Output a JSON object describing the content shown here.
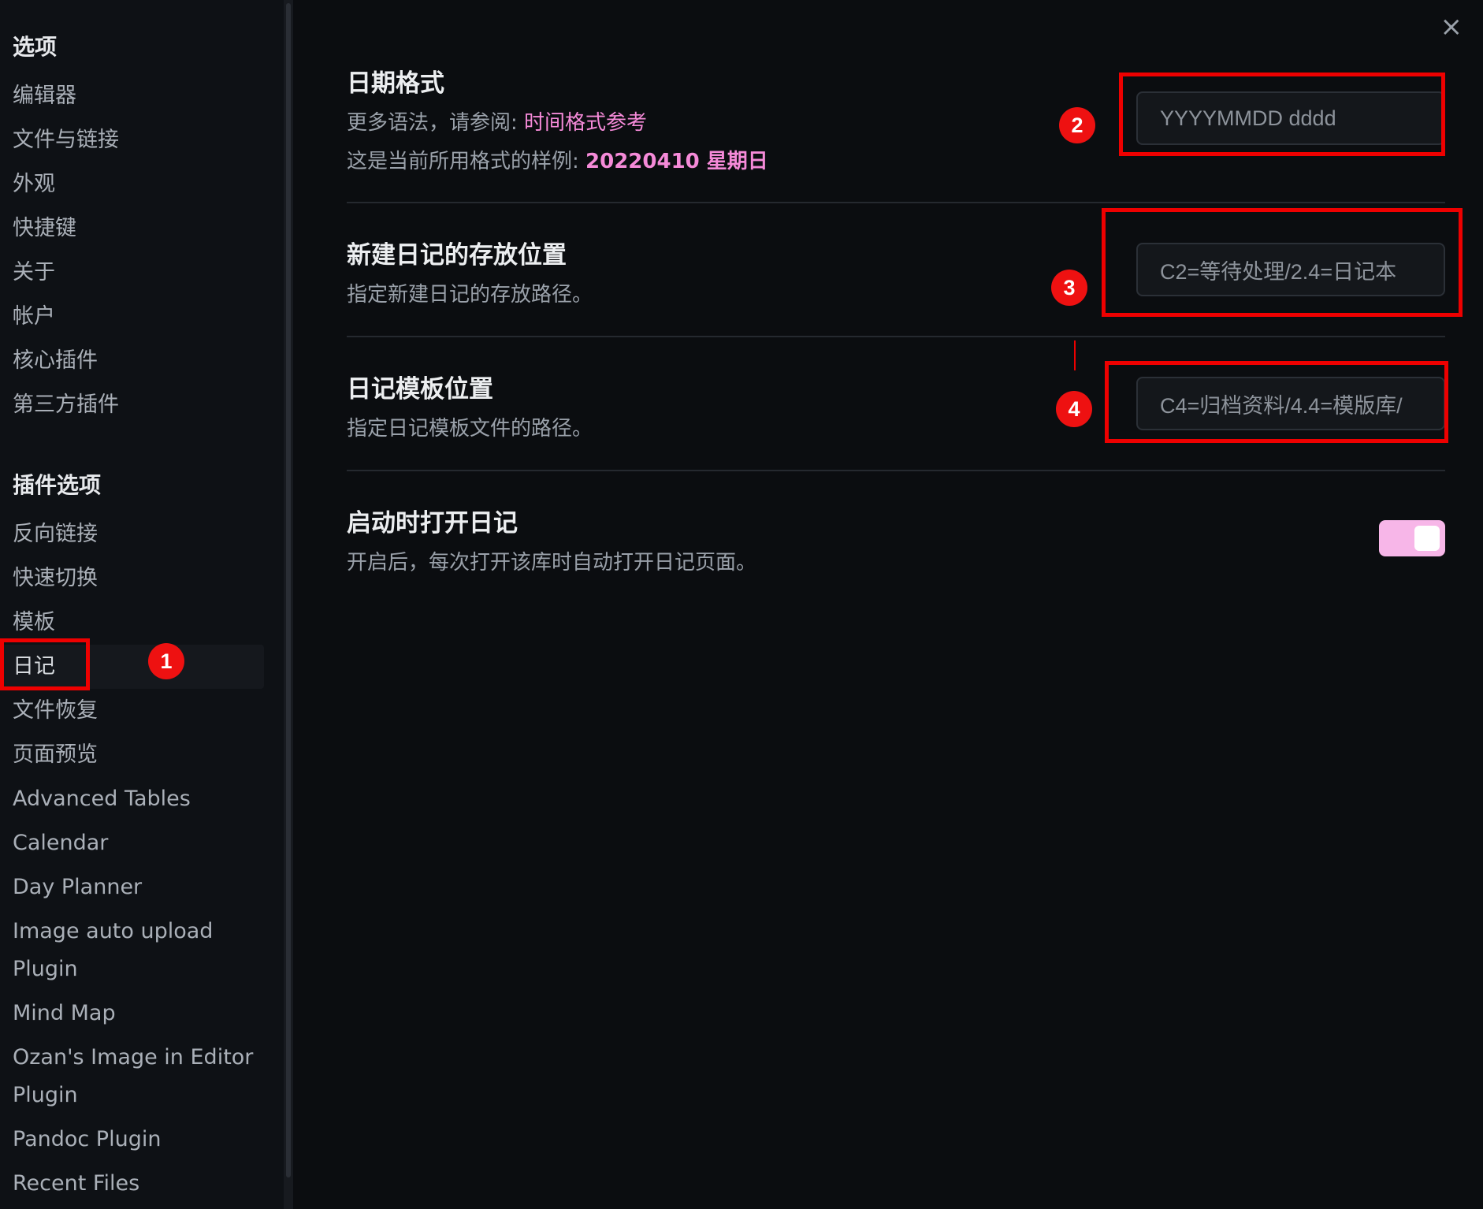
{
  "sidebar": {
    "options_heading": "选项",
    "options_items": [
      "编辑器",
      "文件与链接",
      "外观",
      "快捷键",
      "关于",
      "帐户",
      "核心插件",
      "第三方插件"
    ],
    "plugin_heading": "插件选项",
    "plugin_items": [
      "反向链接",
      "快速切换",
      "模板",
      "日记",
      "文件恢复",
      "页面预览",
      "Advanced Tables",
      "Calendar",
      "Day Planner",
      "Image auto upload Plugin",
      "Mind Map",
      "Ozan's Image in Editor Plugin",
      "Pandoc Plugin",
      "Recent Files"
    ],
    "active_item": "日记"
  },
  "badges": [
    "1",
    "2",
    "3",
    "4"
  ],
  "close_icon": "×",
  "settings": {
    "date_format": {
      "title": "日期格式",
      "desc_prefix": "更多语法，请参阅: ",
      "desc_link": "时间格式参考",
      "sample_prefix": "这是当前所用格式的样例: ",
      "sample_value": "20220410 星期日",
      "value": "YYYYMMDD dddd"
    },
    "folder": {
      "title": "新建日记的存放位置",
      "desc": "指定新建日记的存放路径。",
      "value": "C2=等待处理/2.4=日记本"
    },
    "template": {
      "title": "日记模板位置",
      "desc": "指定日记模板文件的路径。",
      "value": "C4=归档资料/4.4=模版库/"
    },
    "open_on_startup": {
      "title": "启动时打开日记",
      "desc": "开启后，每次打开该库时自动打开日记页面。",
      "enabled": true
    }
  },
  "colors": {
    "accent": "#f58ad8",
    "highlight": "#ee0000",
    "toggle_on": "#f7b6e8"
  }
}
